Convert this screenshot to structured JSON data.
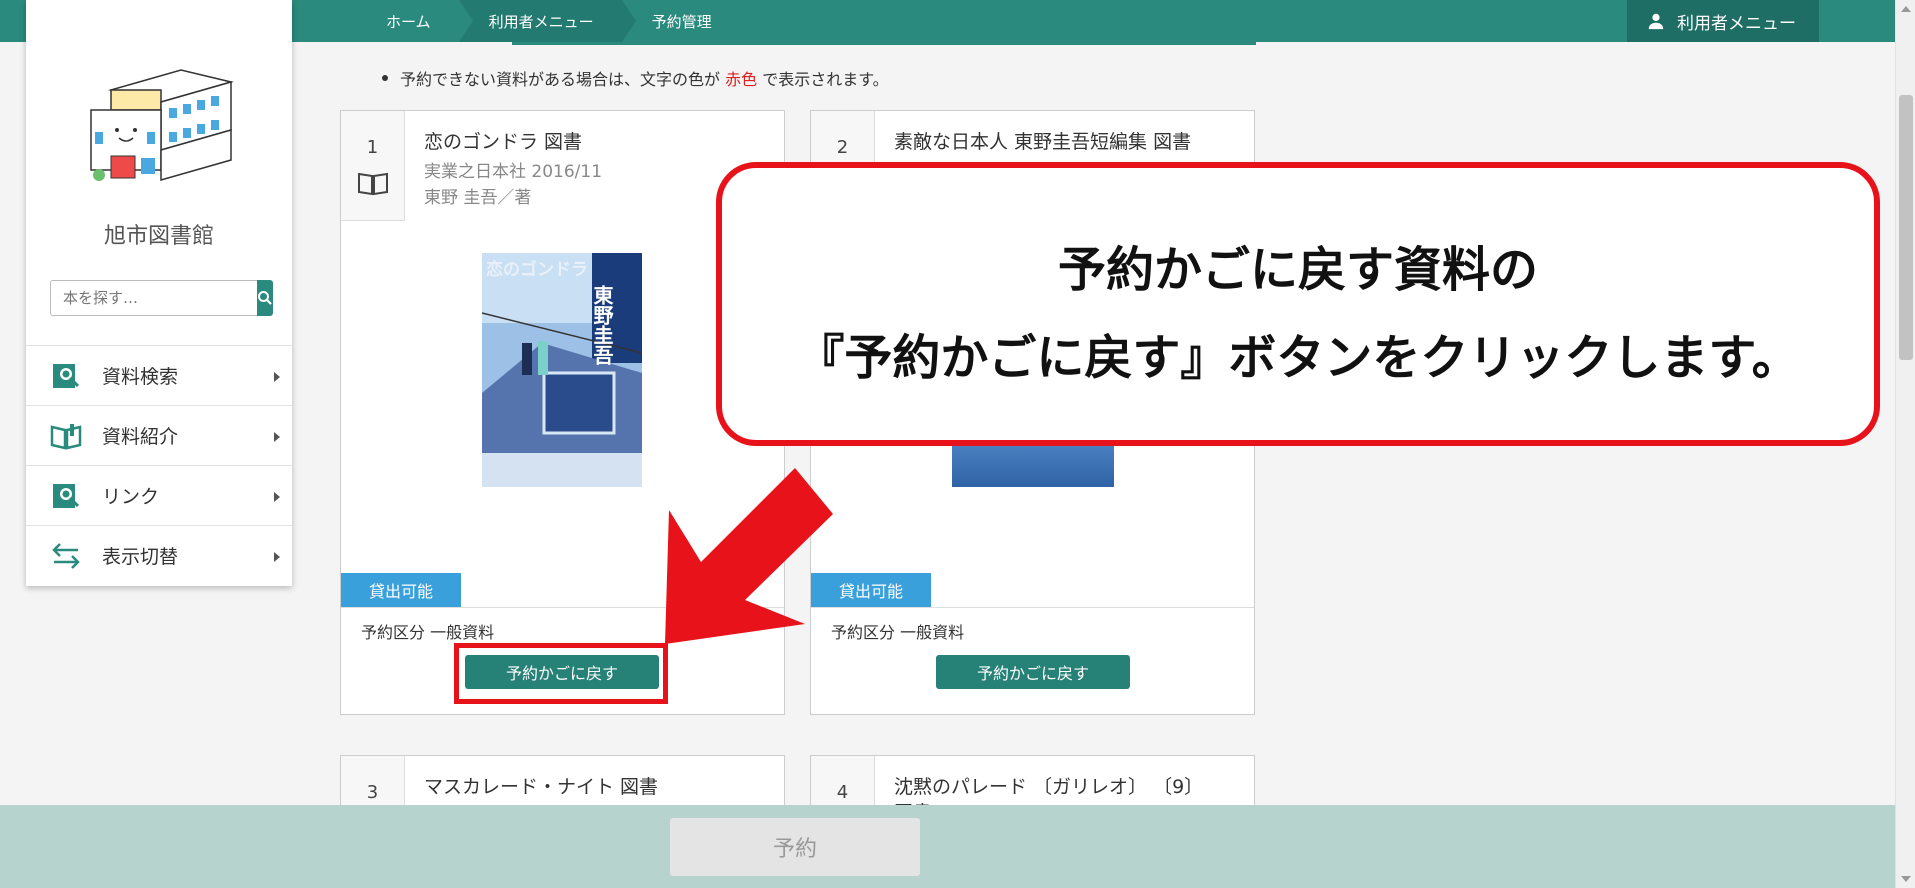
{
  "breadcrumb": {
    "home": "ホーム",
    "user_menu": "利用者メニュー",
    "current": "予約管理"
  },
  "header": {
    "user_menu_label": "利用者メニュー"
  },
  "sidebar": {
    "library_name": "旭市図書館",
    "search_placeholder": "本を探す…",
    "items": [
      {
        "label": "資料検索",
        "icon": "book-search-icon"
      },
      {
        "label": "資料紹介",
        "icon": "open-book-icon"
      },
      {
        "label": "リンク",
        "icon": "book-search-icon"
      },
      {
        "label": "表示切替",
        "icon": "swap-icon"
      }
    ]
  },
  "notice": {
    "before": "予約できない資料がある場合は、文字の色が",
    "red_word": "赤色",
    "after": "で表示されます。"
  },
  "cards": [
    {
      "number": "1",
      "title": "恋のゴンドラ 図書",
      "publisher": "実業之日本社 2016/11",
      "author": "東野 圭吾／著",
      "status": "貸出可能",
      "kubun": "予約区分 一般資料",
      "button": "予約かごに戻す",
      "cover_title": "恋のゴンドラ",
      "cover_author": "東野圭吾"
    },
    {
      "number": "2",
      "title": "素敵な日本人 東野圭吾短編集 図書",
      "status": "貸出可能",
      "kubun": "予約区分 一般資料",
      "button": "予約かごに戻す"
    },
    {
      "number": "3",
      "title": "マスカレード・ナイト 図書"
    },
    {
      "number": "4",
      "title": "沈黙のパレード 〔ガリレオ〕 〔9〕",
      "title_line2": "図書"
    }
  ],
  "callout": {
    "line1": "予約かごに戻す資料の",
    "line2": "『予約かごに戻す』ボタンをクリックします。"
  },
  "footer": {
    "reserve_button": "予約"
  },
  "colors": {
    "primary": "#2a8a7e",
    "button": "#268177",
    "badge": "#3aa0dc",
    "callout_red": "#e8121a",
    "footer_bg": "#b7d3ce"
  }
}
